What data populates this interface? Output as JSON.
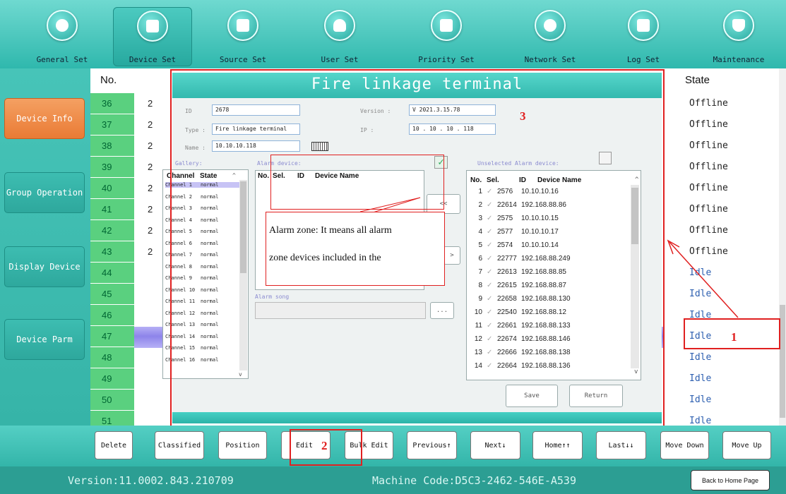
{
  "nav": [
    {
      "label": "General Set",
      "icon": "gear-icon"
    },
    {
      "label": "Device Set",
      "icon": "grid-icon",
      "active": true
    },
    {
      "label": "Source Set",
      "icon": "music-note-icon"
    },
    {
      "label": "User Set",
      "icon": "user-icon"
    },
    {
      "label": "Priority Set",
      "icon": "bar-chart-icon"
    },
    {
      "label": "Network Set",
      "icon": "globe-icon"
    },
    {
      "label": "Log Set",
      "icon": "calendar-icon"
    },
    {
      "label": "Maintenance",
      "icon": "shield-icon"
    }
  ],
  "sidebar": [
    {
      "label": "Device Info",
      "active": true
    },
    {
      "label": "Group Operation"
    },
    {
      "label": "Display Device"
    },
    {
      "label": "Device Parm"
    }
  ],
  "table": {
    "no_header": "No.",
    "state_header": "State",
    "rows": [
      {
        "no": "36",
        "frag": "2",
        "state": "Offline"
      },
      {
        "no": "37",
        "frag": "2",
        "state": "Offline"
      },
      {
        "no": "38",
        "frag": "2",
        "state": "Offline"
      },
      {
        "no": "39",
        "frag": "2",
        "state": "Offline"
      },
      {
        "no": "40",
        "frag": "2",
        "state": "Offline"
      },
      {
        "no": "41",
        "frag": "2",
        "state": "Offline"
      },
      {
        "no": "42",
        "frag": "2",
        "state": "Offline"
      },
      {
        "no": "43",
        "frag": "2",
        "state": "Offline"
      },
      {
        "no": "44",
        "frag": "",
        "state": "Idle"
      },
      {
        "no": "45",
        "frag": "",
        "state": "Idle"
      },
      {
        "no": "46",
        "frag": "",
        "state": "Idle"
      },
      {
        "no": "47",
        "frag": "",
        "state": "Idle"
      },
      {
        "no": "48",
        "frag": "",
        "state": "Idle"
      },
      {
        "no": "49",
        "frag": "",
        "state": "Idle"
      },
      {
        "no": "50",
        "frag": "",
        "state": "Idle"
      },
      {
        "no": "51",
        "frag": "",
        "state": "Idle"
      }
    ],
    "selected_no": "47"
  },
  "dialog": {
    "title": "Fire linkage terminal",
    "id_label": "ID",
    "id_value": "2678",
    "version_label": "Version  :",
    "version_value": "V 2021.3.15.78",
    "type_label": "Type :",
    "type_value": "Fire linkage terminal",
    "ip_label": "IP   :",
    "ip_value": "10 . 10 . 10 . 118",
    "name_label": "Name :",
    "name_value": "10.10.10.118",
    "gallery_label": "Gallery:",
    "alarm_device_label": "Alarm device:",
    "unselected_label": "Unselected Alarm device:",
    "alarm_song_label": "Alarm song",
    "channel_header": "Channel",
    "state_header": "State",
    "channels": [
      {
        "name": "Channel 1",
        "state": "normal"
      },
      {
        "name": "Channel 2",
        "state": "normal"
      },
      {
        "name": "Channel 3",
        "state": "normal"
      },
      {
        "name": "Channel 4",
        "state": "normal"
      },
      {
        "name": "Channel 5",
        "state": "normal"
      },
      {
        "name": "Channel 6",
        "state": "normal"
      },
      {
        "name": "Channel 7",
        "state": "normal"
      },
      {
        "name": "Channel 8",
        "state": "normal"
      },
      {
        "name": "Channel 9",
        "state": "normal"
      },
      {
        "name": "Channel 10",
        "state": "normal"
      },
      {
        "name": "Channel 11",
        "state": "normal"
      },
      {
        "name": "Channel 12",
        "state": "normal"
      },
      {
        "name": "Channel 13",
        "state": "normal"
      },
      {
        "name": "Channel 14",
        "state": "normal"
      },
      {
        "name": "Channel 15",
        "state": "normal"
      },
      {
        "name": "Channel 16",
        "state": "normal"
      }
    ],
    "alarm_cols": {
      "no": "No.",
      "sel": "Sel.",
      "id": "ID",
      "name": "Device Name"
    },
    "unselected": [
      {
        "no": "1",
        "id": "2576",
        "name": "10.10.10.16"
      },
      {
        "no": "2",
        "id": "22614",
        "name": "192.168.88.86"
      },
      {
        "no": "3",
        "id": "2575",
        "name": "10.10.10.15"
      },
      {
        "no": "4",
        "id": "2577",
        "name": "10.10.10.17"
      },
      {
        "no": "5",
        "id": "2574",
        "name": "10.10.10.14"
      },
      {
        "no": "6",
        "id": "22777",
        "name": "192.168.88.249"
      },
      {
        "no": "7",
        "id": "22613",
        "name": "192.168.88.85"
      },
      {
        "no": "8",
        "id": "22615",
        "name": "192.168.88.87"
      },
      {
        "no": "9",
        "id": "22658",
        "name": "192.168.88.130"
      },
      {
        "no": "10",
        "id": "22540",
        "name": "192.168.88.12"
      },
      {
        "no": "11",
        "id": "22661",
        "name": "192.168.88.133"
      },
      {
        "no": "12",
        "id": "22674",
        "name": "192.168.88.146"
      },
      {
        "no": "13",
        "id": "22666",
        "name": "192.168.88.138"
      },
      {
        "no": "14",
        "id": "22664",
        "name": "192.168.88.136"
      }
    ],
    "move_left_label": "<<",
    "move_right_label": ">",
    "browse_label": "...",
    "save_label": "Save",
    "return_label": "Return"
  },
  "annotation": {
    "callout_line1": "Alarm zone: It means all alarm",
    "callout_line2": "zone devices included in the",
    "marker_1": "1",
    "marker_2": "2",
    "marker_3": "3"
  },
  "toolbar": [
    "Delete",
    "Classified",
    "Position",
    "Edit",
    "Bulk Edit",
    "Previous↑",
    "Next↓",
    "Home↑↑",
    "Last↓↓",
    "Move Down",
    "Move Up"
  ],
  "status": {
    "version": "Version:11.0002.843.210709",
    "machine": "Machine Code:D5C3-2462-546E-A539",
    "home_button": "Back to Home Page"
  },
  "colors": {
    "accent": "#33b9ae",
    "active_side": "#ea7b35",
    "highlight": "#8d84ea",
    "annotation": "#e02020",
    "number_cell": "#5ad07f"
  }
}
